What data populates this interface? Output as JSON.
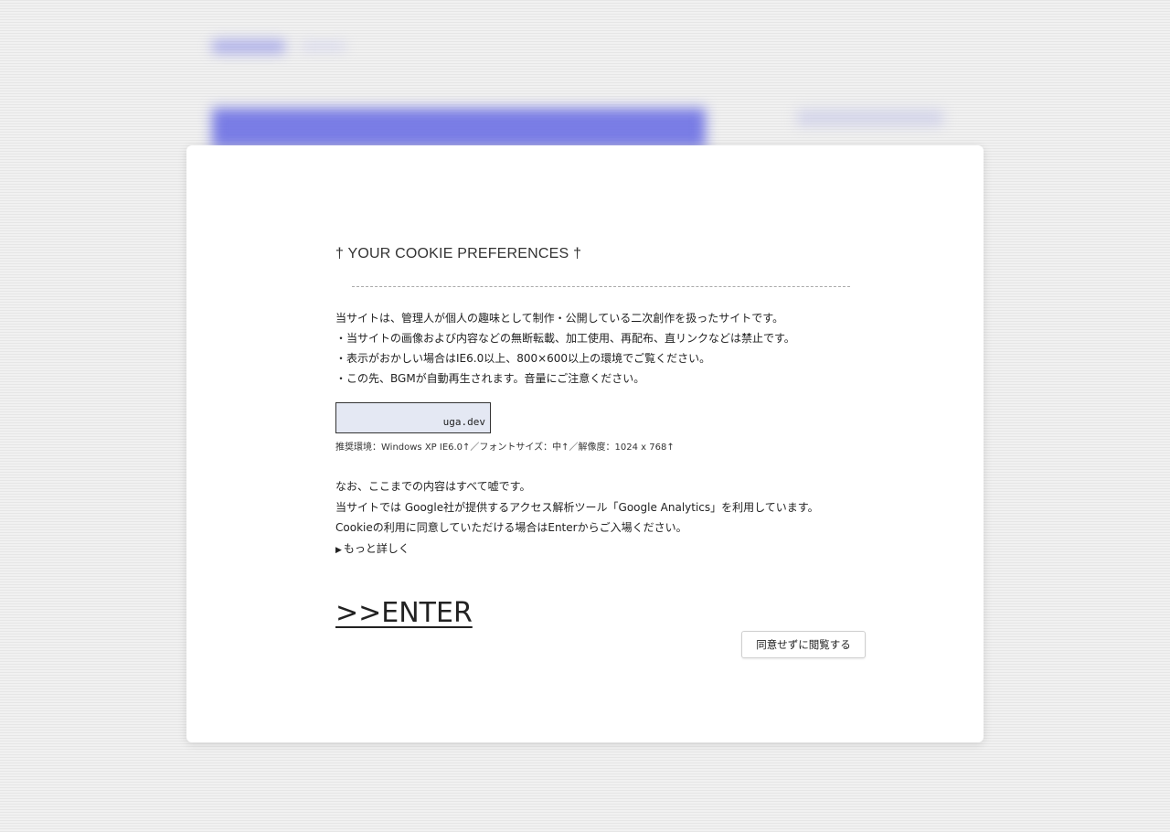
{
  "modal": {
    "title": "† YOUR COOKIE PREFERENCES †",
    "intro_lines": [
      "当サイトは、管理人が個人の趣味として制作・公開している二次創作を扱ったサイトです。",
      "・当サイトの画像および内容などの無断転載、加工使用、再配布、直リンクなどは禁止です。",
      "・表示がおかしい場合はIE6.0以上、800×600以上の環境でご覧ください。",
      "・この先、BGMが自動再生されます。音量にご注意ください。"
    ],
    "banner_text": "uga.dev",
    "env_note": "推奨環境：Windows XP IE6.0↑／フォントサイズ：中↑／解像度：1024 x 768↑",
    "disclaimer_lines": [
      "なお、ここまでの内容はすべて嘘です。",
      "当サイトでは Google社が提供するアクセス解析ツール「Google Analytics」を利用しています。",
      "Cookieの利用に同意していただける場合はEnterからご入場ください。"
    ],
    "details_label": "もっと詳しく",
    "enter_label": ">>ENTER",
    "decline_label": "同意せずに閲覧する"
  }
}
